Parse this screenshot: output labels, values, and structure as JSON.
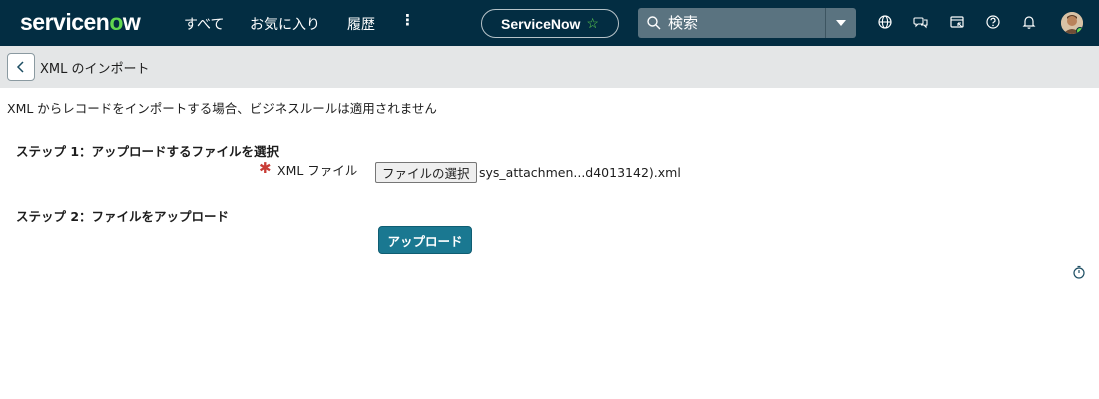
{
  "header": {
    "logo_text_pre": "servicen",
    "logo_text_o": "o",
    "logo_text_post": "w",
    "nav": {
      "all": "すべて",
      "favorites": "お気に入り",
      "history": "履歴",
      "more": "⋮"
    },
    "app_pill_label": "ServiceNow",
    "search_placeholder": "検索",
    "icons": [
      "globe-icon",
      "chat-icon",
      "presence-icon",
      "help-icon",
      "bell-icon"
    ]
  },
  "form": {
    "title": "XML のインポート",
    "note": "XML からレコードをインポートする場合、ビジネスルールは適用されません",
    "step1_label": "ステップ 1：アップロードするファイルを選択",
    "field_label": "XML ファイル",
    "choose_file_label": "ファイルの選択",
    "file_name": "sys_attachmen...d4013142).xml",
    "step2_label": "ステップ 2：ファイルをアップロード",
    "upload_label": "アップロード"
  },
  "colors": {
    "nav_bg": "#032d42",
    "accent_green": "#62d84e",
    "button_bg": "#1a7891",
    "required_red": "#c83c36",
    "form_header_bg": "#e4e6e7"
  }
}
